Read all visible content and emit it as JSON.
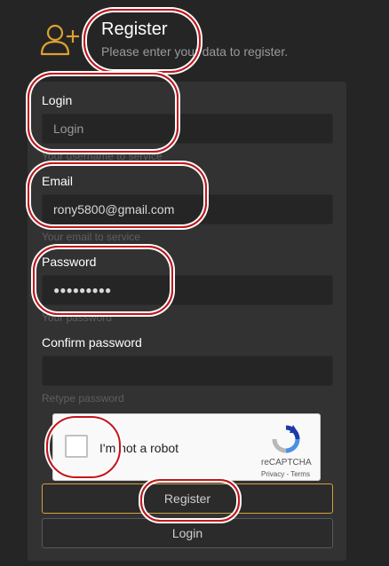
{
  "header": {
    "icon": "add-user-icon",
    "title": "Register",
    "subtitle": "Please enter your data to register."
  },
  "form": {
    "login": {
      "label": "Login",
      "placeholder": "Login",
      "value": "",
      "help": "Your username to service"
    },
    "email": {
      "label": "Email",
      "placeholder": "",
      "value": "rony5800@gmail.com",
      "help": "Your email to service"
    },
    "password": {
      "label": "Password",
      "value": "●●●●●●●●●",
      "help": "Your password"
    },
    "confirm": {
      "label": "Confirm password",
      "value": "",
      "help": "Retype password"
    }
  },
  "recaptcha": {
    "label": "I'm not a robot",
    "brand": "reCAPTCHA",
    "links": "Privacy - Terms",
    "checked": false
  },
  "buttons": {
    "register": "Register",
    "login": "Login"
  },
  "colors": {
    "background": "#252525",
    "panel": "#323232",
    "icon_accent": "#e0a030",
    "register_border": "#d4a13a",
    "highlight_ring": "#c4161c"
  }
}
